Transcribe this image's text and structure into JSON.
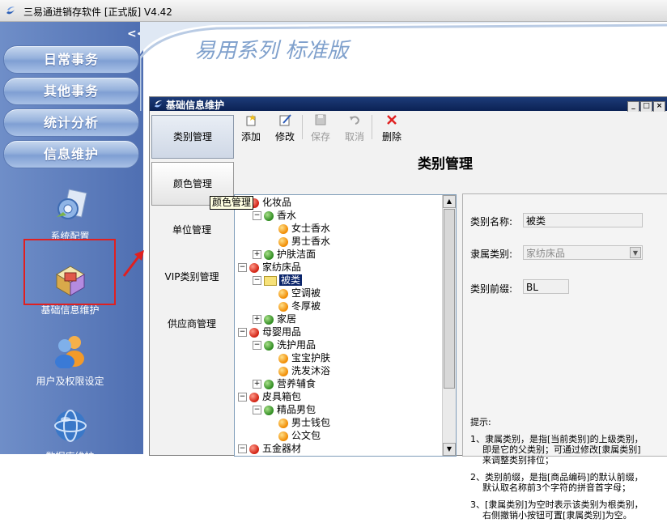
{
  "window": {
    "title": "三易通进销存软件 [正式版] V4.42"
  },
  "brand": {
    "slogan": "易用系列 标准版"
  },
  "leftnav": {
    "collapse": "<<",
    "buttons": [
      "日常事务",
      "其他事务",
      "统计分析",
      "信息维护"
    ],
    "icons": [
      "系统配置",
      "基础信息维护",
      "用户及权限设定",
      "数据库维护"
    ]
  },
  "child": {
    "title": "基础信息维护",
    "window_buttons": [
      "_",
      "□",
      "×"
    ],
    "tabs": [
      "类别管理",
      "颜色管理",
      "单位管理",
      "VIP类别管理",
      "供应商管理"
    ],
    "tooltip": "颜色管理",
    "toolbar": {
      "add": "添加",
      "edit": "修改",
      "save": "保存",
      "cancel": "取消",
      "delete": "删除"
    },
    "heading": "类别管理",
    "tree": [
      {
        "label": "化妆品",
        "ball": "red",
        "level": 0,
        "expanded": true
      },
      {
        "label": "香水",
        "ball": "green",
        "level": 1,
        "expanded": true
      },
      {
        "label": "女士香水",
        "ball": "orange",
        "level": 2
      },
      {
        "label": "男士香水",
        "ball": "orange",
        "level": 2
      },
      {
        "label": "护肤洁面",
        "ball": "green",
        "level": 1
      },
      {
        "label": "家纺床品",
        "ball": "red",
        "level": 0,
        "expanded": true
      },
      {
        "label": "被类",
        "ball": "folder",
        "level": 1,
        "expanded": true,
        "selected": true
      },
      {
        "label": "空调被",
        "ball": "orange",
        "level": 2
      },
      {
        "label": "冬厚被",
        "ball": "orange",
        "level": 2
      },
      {
        "label": "家居",
        "ball": "green",
        "level": 1
      },
      {
        "label": "母婴用品",
        "ball": "red",
        "level": 0,
        "expanded": true
      },
      {
        "label": "洗护用品",
        "ball": "green",
        "level": 1,
        "expanded": true
      },
      {
        "label": "宝宝护肤",
        "ball": "orange",
        "level": 2
      },
      {
        "label": "洗发沐浴",
        "ball": "orange",
        "level": 2
      },
      {
        "label": "营养辅食",
        "ball": "green",
        "level": 1
      },
      {
        "label": "皮具箱包",
        "ball": "red",
        "level": 0,
        "expanded": true
      },
      {
        "label": "精品男包",
        "ball": "green",
        "level": 1,
        "expanded": true
      },
      {
        "label": "男士钱包",
        "ball": "orange",
        "level": 2
      },
      {
        "label": "公文包",
        "ball": "orange",
        "level": 2
      },
      {
        "label": "五金器材",
        "ball": "red",
        "level": 0,
        "expanded": true
      }
    ],
    "form": {
      "name_label": "类别名称:",
      "name_value": "被类",
      "parent_label": "隶属类别:",
      "parent_value": "家纺床品",
      "prefix_label": "类别前缀:",
      "prefix_value": "BL"
    },
    "tips": {
      "title": "提示:",
      "items": [
        {
          "first": "1、隶属类别，是指[当前类别]的上级类别，",
          "rest": [
            "即是它的父类别；可通过修改[隶属类别]",
            "来调整类别排位；"
          ]
        },
        {
          "first": "2、类别前缀，是指[商品编码]的默认前缀，",
          "rest": [
            "默认取名称前3个字符的拼音首字母；"
          ]
        },
        {
          "first": "3、[隶属类别]为空时表示该类别为根类别，",
          "rest": [
            "右侧撤销小按钮可置[隶属类别]为空。"
          ]
        }
      ]
    }
  },
  "colors": {
    "nav_bg": "#5f7fbe",
    "title_blue": "#0b2255",
    "highlight": "#0a246a",
    "annotation_red": "#e02020"
  }
}
